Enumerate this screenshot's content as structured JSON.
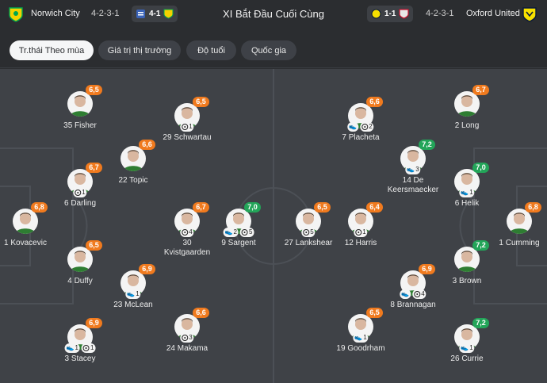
{
  "header": {
    "title": "XI Bắt Đầu Cuối Cùng",
    "home": {
      "name": "Norwich City",
      "formation": "4-2-3-1",
      "color": "#f5d100",
      "accent": "#00a650"
    },
    "away": {
      "name": "Oxford United",
      "formation": "4-2-3-1",
      "color": "#f7e000",
      "accent": "#0a1a3a"
    },
    "prev_home": {
      "score": "4-1"
    },
    "prev_away": {
      "score": "1-1"
    }
  },
  "tabs": [
    {
      "label": "Tr.thái Theo mùa",
      "active": true
    },
    {
      "label": "Giá trị thị trường",
      "active": false
    },
    {
      "label": "Độ tuổi",
      "active": false
    },
    {
      "label": "Quốc gia",
      "active": false
    }
  ],
  "colors": {
    "rating_orange": "#f07a1e",
    "rating_green": "#23a559",
    "pitch": "#3f4247"
  },
  "players": [
    {
      "label": "35 Fisher",
      "rating": "6,5",
      "color": "orange",
      "badges": []
    },
    {
      "label": "29 Schwartau",
      "rating": "6,5",
      "color": "orange",
      "badges": [
        {
          "type": "goal",
          "n": "1"
        }
      ]
    },
    {
      "label": "22 Topic",
      "rating": "6,6",
      "color": "orange",
      "badges": []
    },
    {
      "label": "6 Darling",
      "rating": "6,7",
      "color": "orange",
      "badges": [
        {
          "type": "goal",
          "n": "1"
        }
      ]
    },
    {
      "label": "1 Kovacevic",
      "rating": "6,8",
      "color": "orange",
      "badges": []
    },
    {
      "label": "30 Kvistgaarden",
      "rating": "6,7",
      "color": "orange",
      "badges": [
        {
          "type": "goal",
          "n": "4"
        }
      ]
    },
    {
      "label": "9 Sargent",
      "rating": "7,0",
      "color": "green",
      "badges": [
        {
          "type": "assist",
          "n": "2"
        },
        {
          "type": "goal",
          "n": "5"
        }
      ]
    },
    {
      "label": "4 Duffy",
      "rating": "6,5",
      "color": "orange",
      "badges": []
    },
    {
      "label": "23 McLean",
      "rating": "6,9",
      "color": "orange",
      "badges": [
        {
          "type": "assist",
          "n": "1"
        }
      ]
    },
    {
      "label": "3 Stacey",
      "rating": "6,9",
      "color": "orange",
      "badges": [
        {
          "type": "assist",
          "n": "1"
        },
        {
          "type": "goal",
          "n": "1"
        }
      ]
    },
    {
      "label": "24 Makama",
      "rating": "6,6",
      "color": "orange",
      "badges": [
        {
          "type": "goal",
          "n": "3"
        }
      ]
    },
    {
      "label": "7 Placheta",
      "rating": "6,6",
      "color": "orange",
      "badges": [
        {
          "type": "assist",
          "n": ""
        },
        {
          "type": "goal",
          "n": "2"
        }
      ]
    },
    {
      "label": "2 Long",
      "rating": "6,7",
      "color": "orange",
      "badges": []
    },
    {
      "label": "14 De Keersmaecker",
      "rating": "7,2",
      "color": "green",
      "badges": [
        {
          "type": "assist",
          "n": "3"
        }
      ]
    },
    {
      "label": "6 Helik",
      "rating": "7,0",
      "color": "green",
      "badges": [
        {
          "type": "assist",
          "n": "1"
        }
      ]
    },
    {
      "label": "27 Lankshear",
      "rating": "6,5",
      "color": "orange",
      "badges": [
        {
          "type": "goal",
          "n": "5"
        }
      ]
    },
    {
      "label": "12 Harris",
      "rating": "6,4",
      "color": "orange",
      "badges": [
        {
          "type": "goal",
          "n": "1"
        }
      ]
    },
    {
      "label": "1 Cumming",
      "rating": "6,8",
      "color": "orange",
      "badges": []
    },
    {
      "label": "3 Brown",
      "rating": "7,2",
      "color": "green",
      "badges": []
    },
    {
      "label": "8 Brannagan",
      "rating": "6,9",
      "color": "orange",
      "badges": [
        {
          "type": "assist",
          "n": ""
        },
        {
          "type": "goal",
          "n": "4"
        }
      ]
    },
    {
      "label": "19 Goodrham",
      "rating": "6,5",
      "color": "orange",
      "badges": [
        {
          "type": "assist",
          "n": "1"
        }
      ]
    },
    {
      "label": "26 Currie",
      "rating": "7,2",
      "color": "green",
      "badges": [
        {
          "type": "assist",
          "n": "1"
        }
      ]
    }
  ]
}
